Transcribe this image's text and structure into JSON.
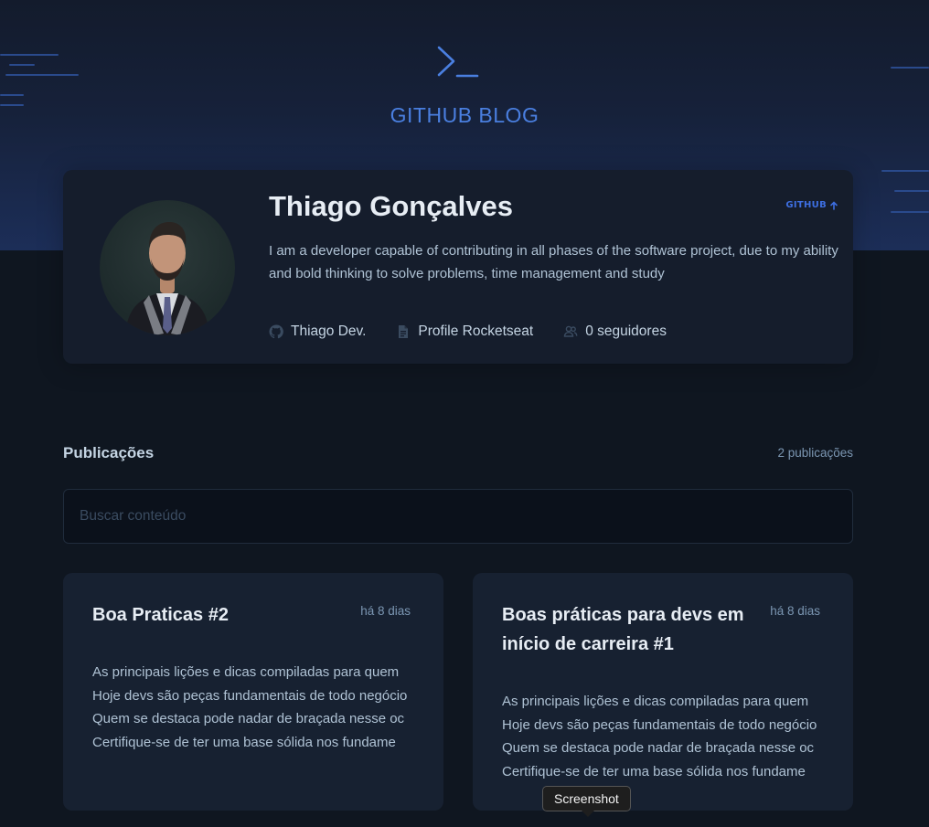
{
  "header": {
    "brand": "GITHUB BLOG",
    "logo_icon": "terminal-prompt-icon",
    "accent": "#4a7fe0"
  },
  "profile": {
    "name": "Thiago Gonçalves",
    "github_link": "GITHUB",
    "bio": "I am a developer capable of contributing in all phases of the software project, due to my ability and bold thinking to solve problems, time management and study",
    "meta": {
      "username": "Thiago Dev.",
      "company": "Profile Rocketseat",
      "followers": "0 seguidores"
    }
  },
  "publications": {
    "title": "Publicações",
    "count": "2 publicações",
    "search_placeholder": "Buscar conteúdo"
  },
  "posts": [
    {
      "title": "Boa Praticas #2",
      "date": "há 8 dias",
      "excerpt": [
        "As principais lições e dicas compiladas para quem",
        "Hoje devs são peças fundamentais de todo negócio",
        "Quem se destaca pode nadar de braçada nesse oc",
        "Certifique-se de ter uma base sólida nos fundame"
      ]
    },
    {
      "title": "Boas práticas para devs em início de carreira #1",
      "date": "há 8 dias",
      "excerpt": [
        "As principais lições e dicas compiladas para quem",
        "Hoje devs são peças fundamentais de todo negócio",
        "Quem se destaca pode nadar de braçada nesse oc",
        "Certifique-se de ter uma base sólida nos fundame"
      ]
    }
  ],
  "tooltip": {
    "label": "Screenshot"
  }
}
